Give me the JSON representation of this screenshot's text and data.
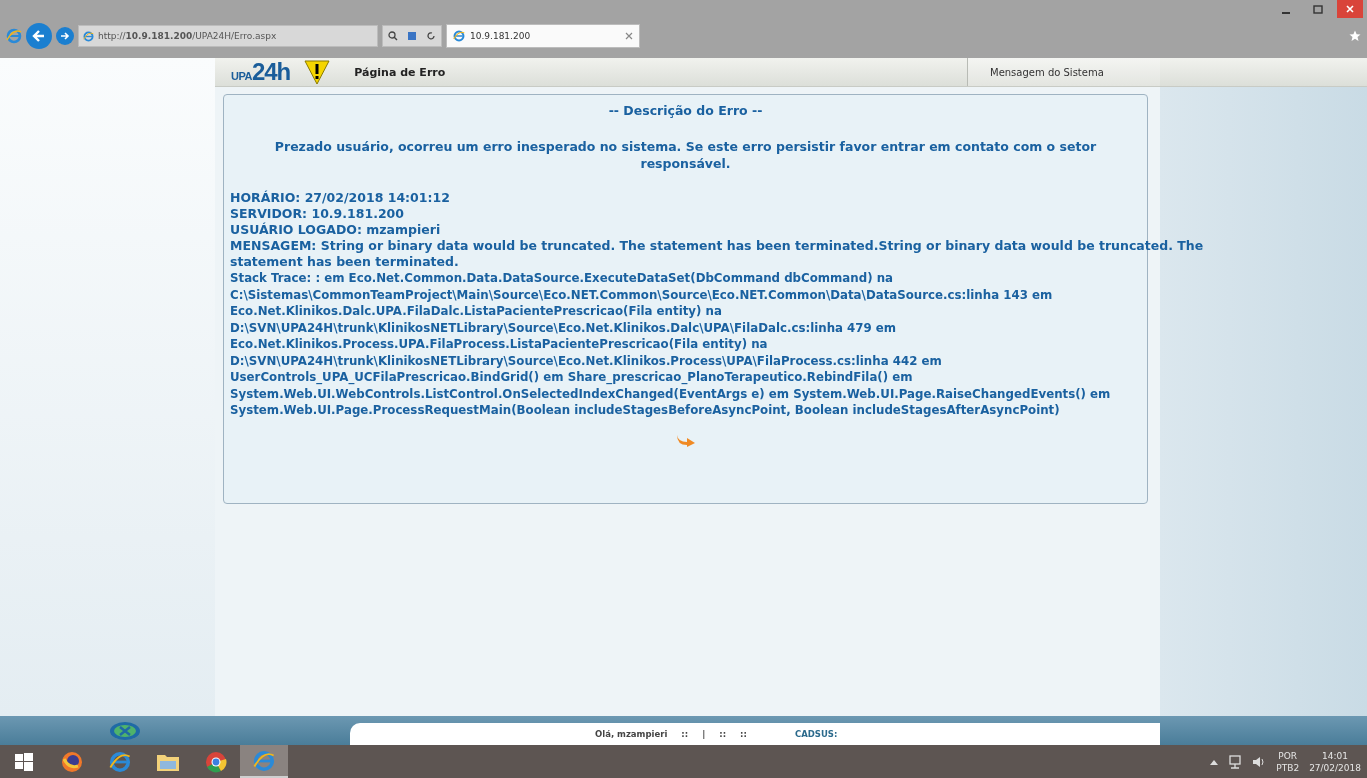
{
  "browser": {
    "address": "http://**10.9.181.200**/UPA24H/Erro.aspx",
    "tabs": [
      {
        "title": "10.9.181.200",
        "selected": true
      }
    ]
  },
  "header": {
    "logo_small": "UPA",
    "logo_big": "24h",
    "title": "Página de Erro",
    "right_tab": "Mensagem do Sistema"
  },
  "error_panel": {
    "heading": "-- Descrição do Erro --",
    "intro": "Prezado usuário, ocorreu um erro inesperado no sistema. Se este erro persistir favor entrar em contato com o setor responsável.",
    "details": [
      "HORÁRIO: 27/02/2018 14:01:12",
      "SERVIDOR: 10.9.181.200",
      "USUÁRIO LOGADO: mzampieri",
      "MENSAGEM: String or binary data would be truncated. The statement has been terminated.String or binary data would be truncated. The statement has been terminated."
    ],
    "stack_trace": "Stack Trace: : em Eco.Net.Common.Data.DataSource.ExecuteDataSet(DbCommand dbCommand) na C:\\Sistemas\\CommonTeamProject\\Main\\Source\\Eco.NET.Common\\Source\\Eco.NET.Common\\Data\\DataSource.cs:linha 143 em Eco.Net.Klinikos.Dalc.UPA.FilaDalc.ListaPacientePrescricao(Fila entity) na D:\\SVN\\UPA24H\\trunk\\KlinikosNETLibrary\\Source\\Eco.Net.Klinikos.Dalc\\UPA\\FilaDalc.cs:linha 479 em Eco.Net.Klinikos.Process.UPA.FilaProcess.ListaPacientePrescricao(Fila entity) na D:\\SVN\\UPA24H\\trunk\\KlinikosNETLibrary\\Source\\Eco.Net.Klinikos.Process\\UPA\\FilaProcess.cs:linha 442 em UserControls_UPA_UCFilaPrescricao.BindGrid() em Share_prescricao_PlanoTerapeutico.RebindFila() em System.Web.UI.WebControls.ListControl.OnSelectedIndexChanged(EventArgs e) em System.Web.UI.Page.RaiseChangedEvents() em System.Web.UI.Page.ProcessRequestMain(Boolean includeStagesBeforeAsyncPoint, Boolean includeStagesAfterAsyncPoint)"
  },
  "footer": {
    "greeting": "Olá, mzampieri",
    "separators": [
      "::",
      "|",
      "::",
      "::"
    ],
    "cadsus": "CADSUS:"
  },
  "taskbar": {
    "apps": [
      {
        "kind": "firefox",
        "active": false
      },
      {
        "kind": "ie",
        "active": false
      },
      {
        "kind": "folder",
        "active": false
      },
      {
        "kind": "chrome",
        "active": false
      },
      {
        "kind": "ie",
        "active": true
      }
    ],
    "language": "POR",
    "layout": "PTB2",
    "time": "14:01",
    "date": "27/02/2018"
  }
}
